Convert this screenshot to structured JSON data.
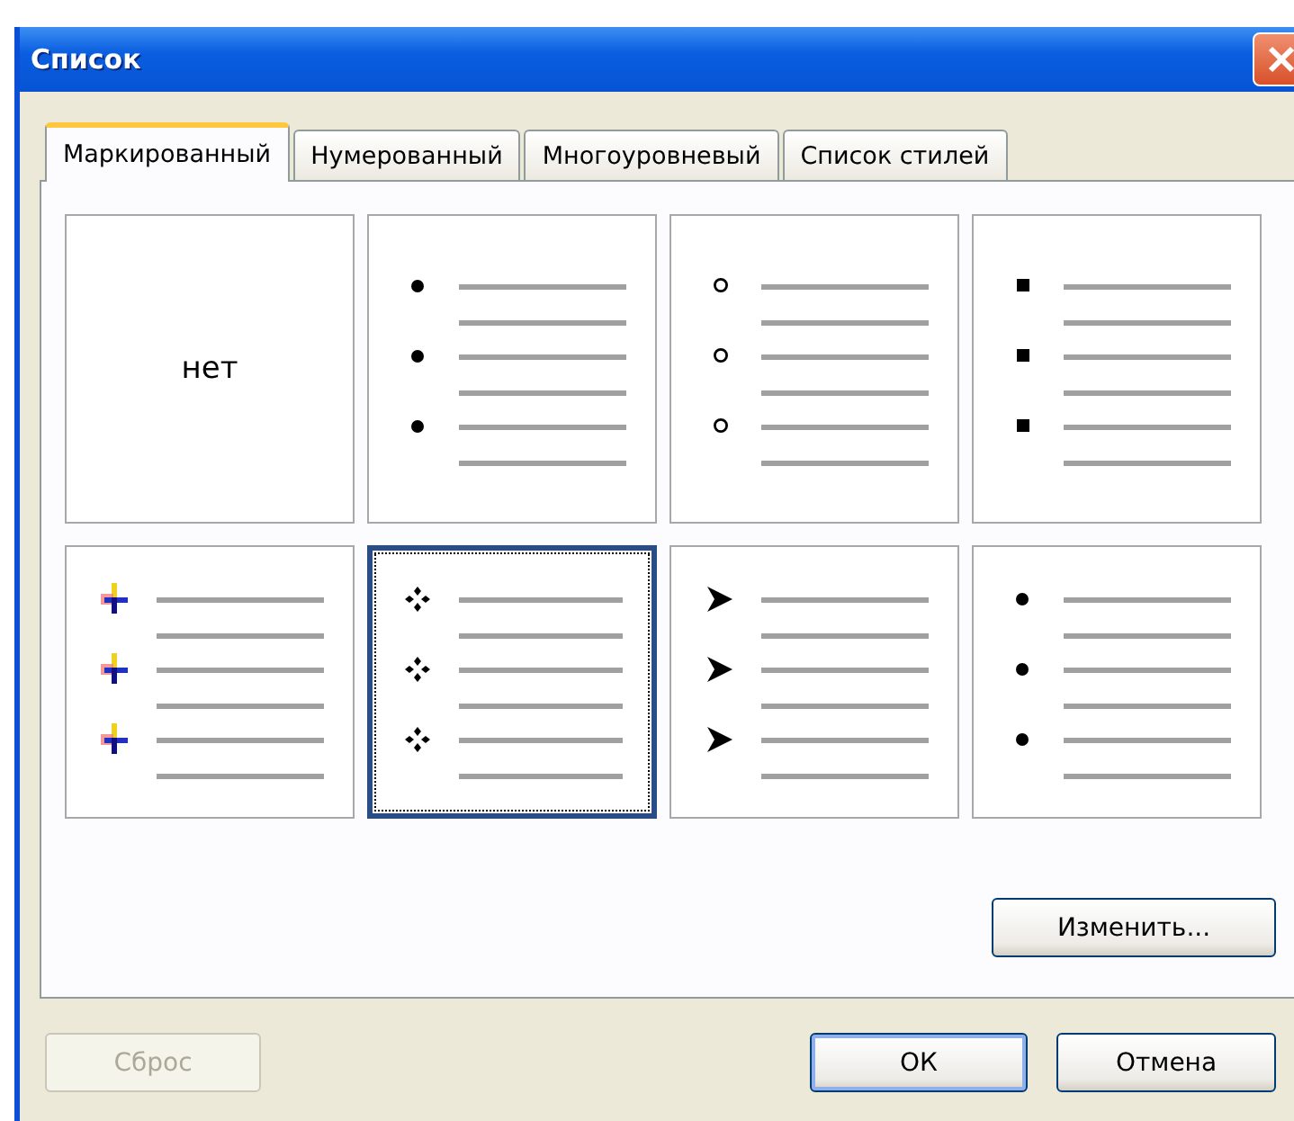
{
  "window": {
    "title": "Список"
  },
  "tabs": [
    {
      "label": "Маркированный",
      "selected": true
    },
    {
      "label": "Нумерованный",
      "selected": false
    },
    {
      "label": "Многоуровневый",
      "selected": false
    },
    {
      "label": "Список стилей",
      "selected": false
    }
  ],
  "cells": [
    {
      "kind": "none",
      "label": "нет",
      "selected": false
    },
    {
      "kind": "disc",
      "selected": false
    },
    {
      "kind": "circle",
      "selected": false
    },
    {
      "kind": "square",
      "selected": false
    },
    {
      "kind": "picture",
      "selected": false
    },
    {
      "kind": "diamonds",
      "selected": true
    },
    {
      "kind": "arrowhead",
      "selected": false
    },
    {
      "kind": "disc",
      "selected": false
    }
  ],
  "modify_button": "Изменить...",
  "buttons": [
    {
      "label": "Сброс",
      "disabled": true
    },
    {
      "label": "ОК",
      "disabled": false
    },
    {
      "label": "Отмена",
      "disabled": false
    }
  ]
}
